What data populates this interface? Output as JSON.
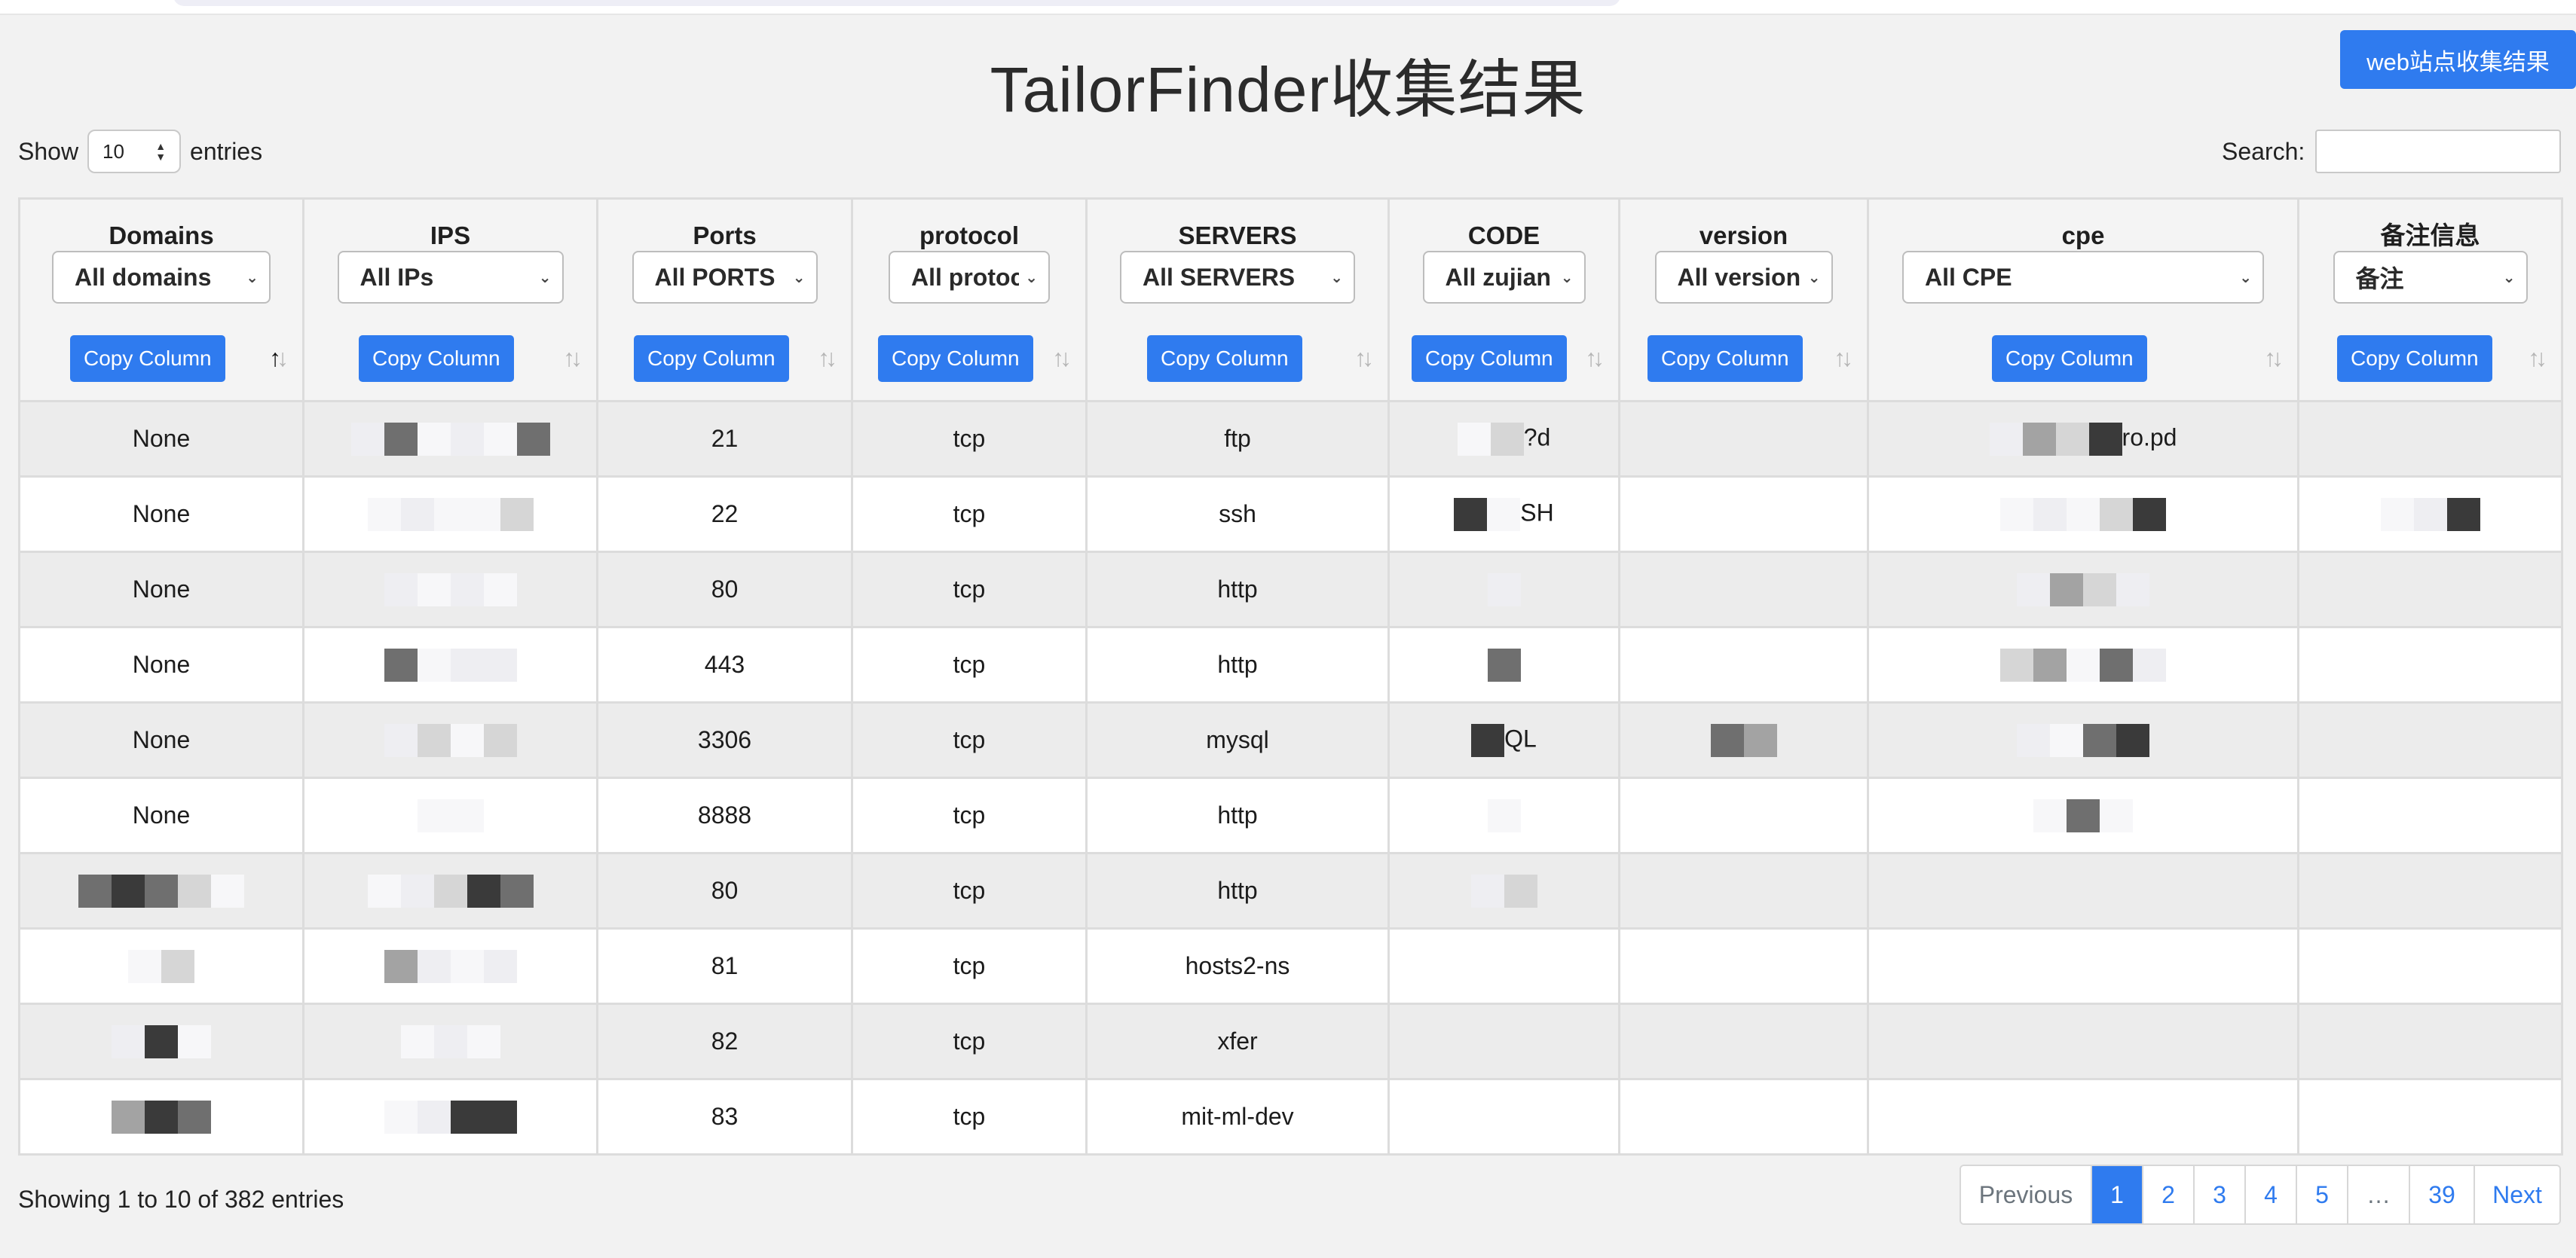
{
  "header": {
    "title": "TailorFinder收集结果",
    "web_button": "web站点收集结果"
  },
  "controls": {
    "show_label": "Show",
    "entries_value": "10",
    "entries_label": "entries",
    "search_label": "Search:",
    "search_value": ""
  },
  "columns": [
    {
      "title": "Domains",
      "filter": "All domains",
      "copy": "Copy Column"
    },
    {
      "title": "IPS",
      "filter": "All IPs",
      "copy": "Copy Column"
    },
    {
      "title": "Ports",
      "filter": "All PORTS",
      "copy": "Copy Column"
    },
    {
      "title": "protocol",
      "filter": "All protoc",
      "copy": "Copy Column"
    },
    {
      "title": "SERVERS",
      "filter": "All SERVERS",
      "copy": "Copy Column"
    },
    {
      "title": "CODE",
      "filter": "All zujian",
      "copy": "Copy Column"
    },
    {
      "title": "version",
      "filter": "All version",
      "copy": "Copy Column"
    },
    {
      "title": "cpe",
      "filter": "All CPE",
      "copy": "Copy Column"
    },
    {
      "title": "备注信息",
      "filter": "备注",
      "copy": "Copy Column"
    }
  ],
  "rows": [
    {
      "domain": "None",
      "port": "21",
      "protocol": "tcp",
      "server": "ftp",
      "code": "?d",
      "cpe": "ro.pd"
    },
    {
      "domain": "None",
      "port": "22",
      "protocol": "tcp",
      "server": "ssh",
      "code": "SH"
    },
    {
      "domain": "None",
      "port": "80",
      "protocol": "tcp",
      "server": "http"
    },
    {
      "domain": "None",
      "port": "443",
      "protocol": "tcp",
      "server": "http"
    },
    {
      "domain": "None",
      "port": "3306",
      "protocol": "tcp",
      "server": "mysql",
      "code": "QL"
    },
    {
      "domain": "None",
      "port": "8888",
      "protocol": "tcp",
      "server": "http"
    },
    {
      "domain": "",
      "port": "80",
      "protocol": "tcp",
      "server": "http"
    },
    {
      "domain": "",
      "port": "81",
      "protocol": "tcp",
      "server": "hosts2-ns"
    },
    {
      "domain": "",
      "port": "82",
      "protocol": "tcp",
      "server": "xfer"
    },
    {
      "domain": "",
      "port": "83",
      "protocol": "tcp",
      "server": "mit-ml-dev"
    }
  ],
  "footer": {
    "info": "Showing 1 to 10 of 382 entries",
    "pagination": [
      "Previous",
      "1",
      "2",
      "3",
      "4",
      "5",
      "…",
      "39",
      "Next"
    ],
    "active_page": "1"
  },
  "colors": {
    "accent": "#2f7bef",
    "row_odd": "#ececec",
    "row_even": "#ffffff",
    "page_bg": "#f2f2f2"
  }
}
